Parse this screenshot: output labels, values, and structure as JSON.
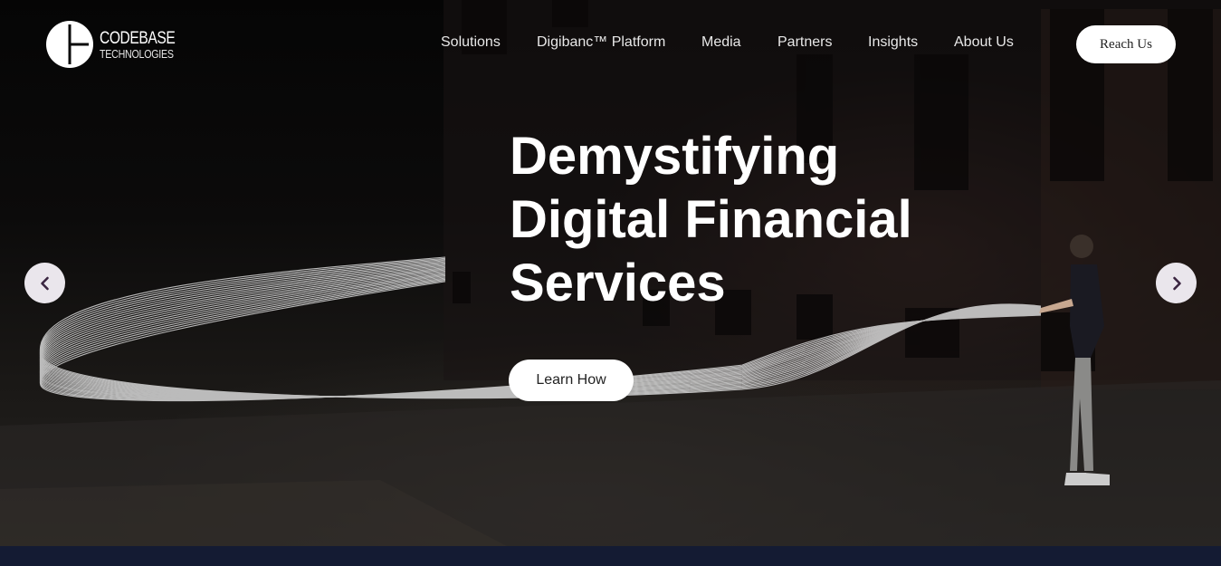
{
  "brand": {
    "line1": "CODEBASE",
    "line2": "TECHNOLOGIES"
  },
  "nav": {
    "items": [
      {
        "label": "Solutions"
      },
      {
        "label": "Digibanc™ Platform"
      },
      {
        "label": "Media"
      },
      {
        "label": "Partners"
      },
      {
        "label": "Insights"
      },
      {
        "label": "About Us"
      }
    ],
    "cta_label": "Reach Us"
  },
  "hero": {
    "headline_lines": [
      "Demystifying",
      "Digital Financial",
      "Services"
    ],
    "cta_label": "Learn How"
  },
  "carousel": {
    "prev_icon": "chevron-left-icon",
    "next_icon": "chevron-right-icon"
  },
  "colors": {
    "accent": "#3a2540",
    "band": "#141b33"
  }
}
